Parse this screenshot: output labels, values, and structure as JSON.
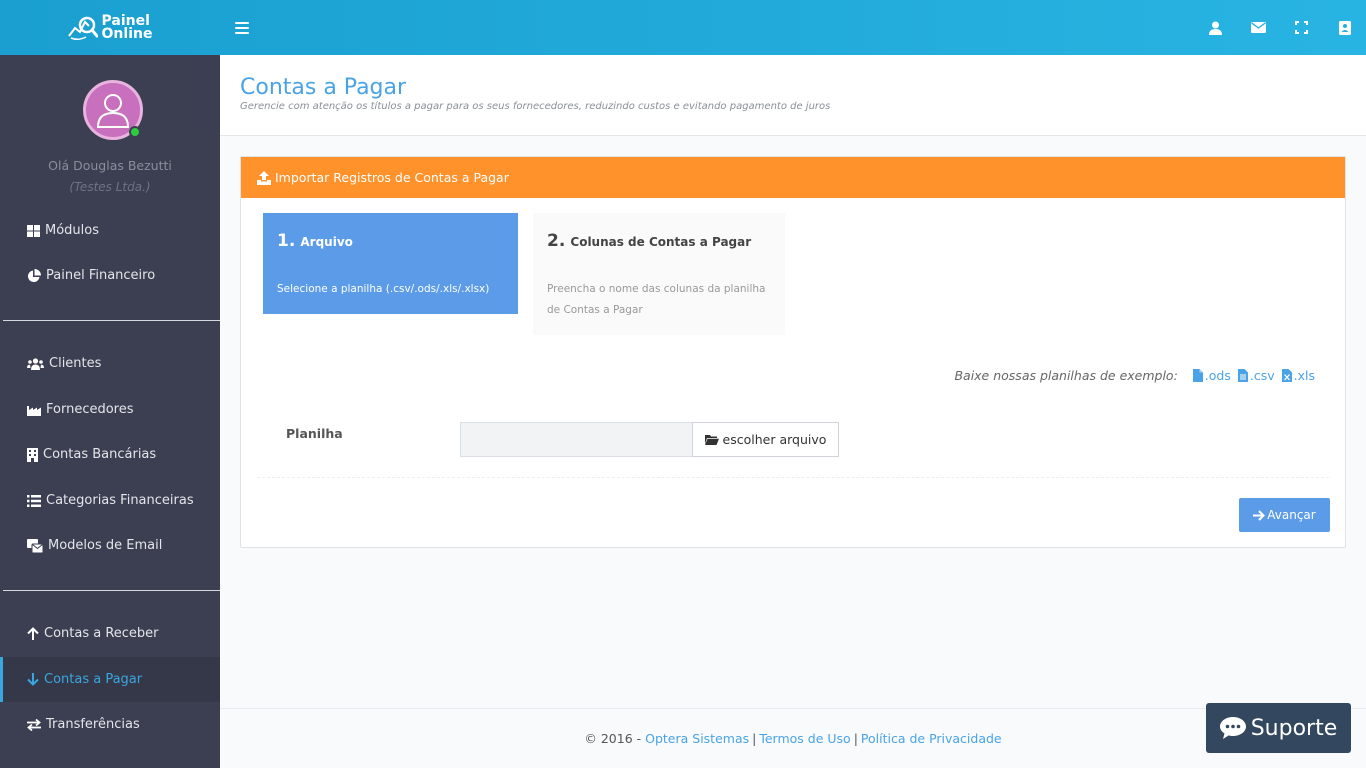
{
  "app": {
    "logo_line1": "Painel",
    "logo_line2": "Online"
  },
  "topbar": {
    "icons": [
      "user-icon",
      "envelope-icon",
      "fullscreen-icon",
      "address-book-icon"
    ]
  },
  "user": {
    "greeting": "Olá Douglas Bezutti",
    "company": "(Testes Ltda.)"
  },
  "sidebar": {
    "items": [
      {
        "label": "Módulos",
        "icon": "grid-icon"
      },
      {
        "label": "Painel Financeiro",
        "icon": "pie-chart-icon"
      },
      {
        "label": "Clientes",
        "icon": "users-icon"
      },
      {
        "label": "Fornecedores",
        "icon": "industry-icon"
      },
      {
        "label": "Contas Bancárias",
        "icon": "building-icon"
      },
      {
        "label": "Categorias Financeiras",
        "icon": "list-icon"
      },
      {
        "label": "Modelos de Email",
        "icon": "email-template-icon"
      },
      {
        "label": "Contas a Receber",
        "icon": "arrow-up-icon"
      },
      {
        "label": "Contas a Pagar",
        "icon": "arrow-down-icon"
      },
      {
        "label": "Transferências",
        "icon": "exchange-icon"
      }
    ],
    "active": "Contas a Pagar"
  },
  "header": {
    "title": "Contas a Pagar",
    "subtitle": "Gerencie com atenção os títulos a pagar para os seus fornecedores, reduzindo custos e evitando pagamento de juros"
  },
  "panel": {
    "title": "Importar Registros de Contas a Pagar",
    "steps": [
      {
        "num": "1.",
        "title": "Arquivo",
        "desc": "Selecione a planilha (.csv/.ods/.xls/.xlsx)"
      },
      {
        "num": "2.",
        "title": "Colunas de Contas a Pagar",
        "desc": "Preencha o nome das colunas da planilha de Contas a Pagar"
      }
    ],
    "examples_label": "Baixe nossas planilhas de exemplo:",
    "examples": [
      ".ods",
      ".csv",
      ".xls"
    ],
    "field_label": "Planilha",
    "file_input_value": "",
    "file_button": "escolher arquivo",
    "next_button": "Avançar"
  },
  "footer": {
    "copyright": "© 2016 -",
    "company_link": "Optera Sistemas",
    "terms_link": "Termos de Uso",
    "privacy_link": "Política de Privacidade",
    "separator": "|"
  },
  "support": {
    "label": "Suporte"
  },
  "colors": {
    "topbar": "#1a9fd0",
    "sidebar": "#3b3f51",
    "accent": "#4aa3e6",
    "panel_header": "#ff922b",
    "step_active": "#5b9be8"
  }
}
